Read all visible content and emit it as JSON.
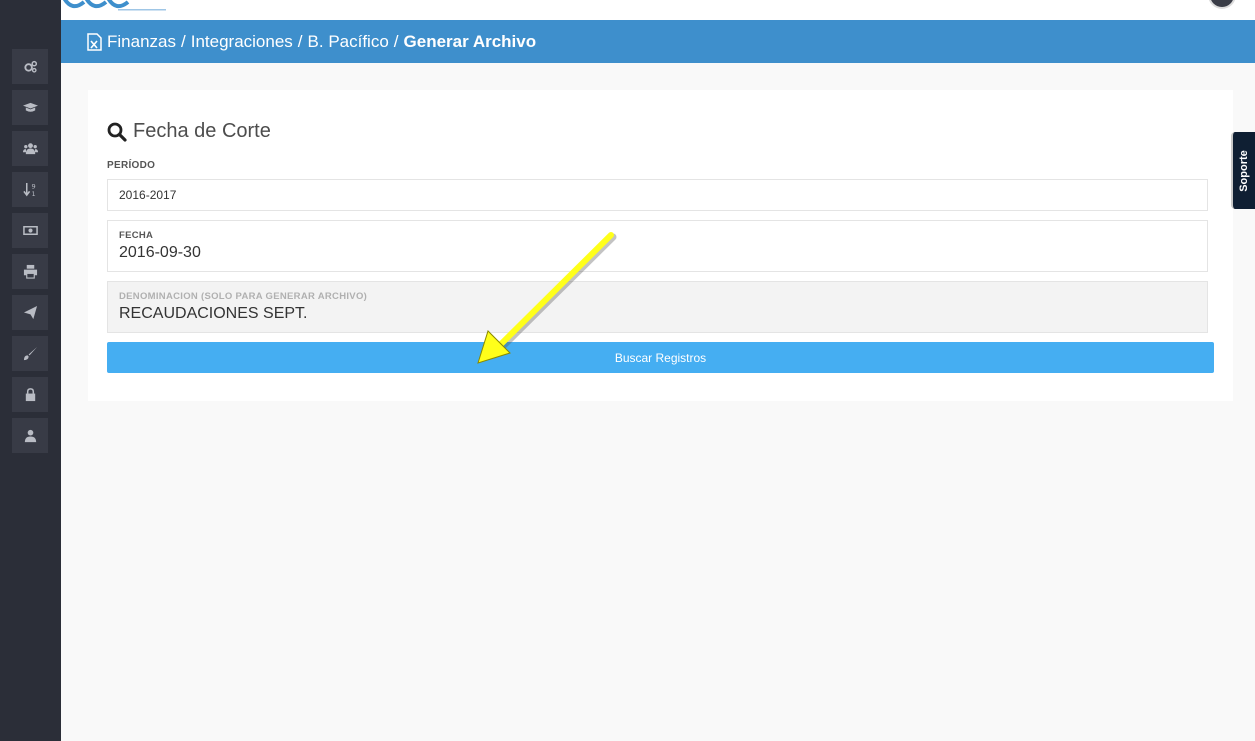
{
  "header": {
    "breadcrumb": [
      "Finanzas",
      "Integraciones",
      "B. Pacífico"
    ],
    "separator": "/",
    "current": "Generar Archivo"
  },
  "panel": {
    "title": "Fecha de Corte",
    "periodo": {
      "label": "PERÍODO",
      "value": "2016-2017"
    },
    "fecha": {
      "label": "FECHA",
      "value": "2016-09-30"
    },
    "denominacion": {
      "label": "DENOMINACION (SOLO PARA GENERAR ARCHIVO)",
      "value": "RECAUDACIONES SEPT."
    },
    "button_label": "Buscar Registros"
  },
  "soporte_label": "Soporte",
  "sidebar": {
    "icons": [
      "gears-icon",
      "graduation-cap-icon",
      "users-icon",
      "sort-numeric-icon",
      "money-icon",
      "print-icon",
      "paper-plane-icon",
      "paint-brush-icon",
      "lock-icon",
      "user-icon"
    ]
  },
  "colors": {
    "header": "#3e8fcc",
    "sidebar": "#2b2e38",
    "button": "#45aef2",
    "annotation_arrow": "#ffff1a"
  }
}
